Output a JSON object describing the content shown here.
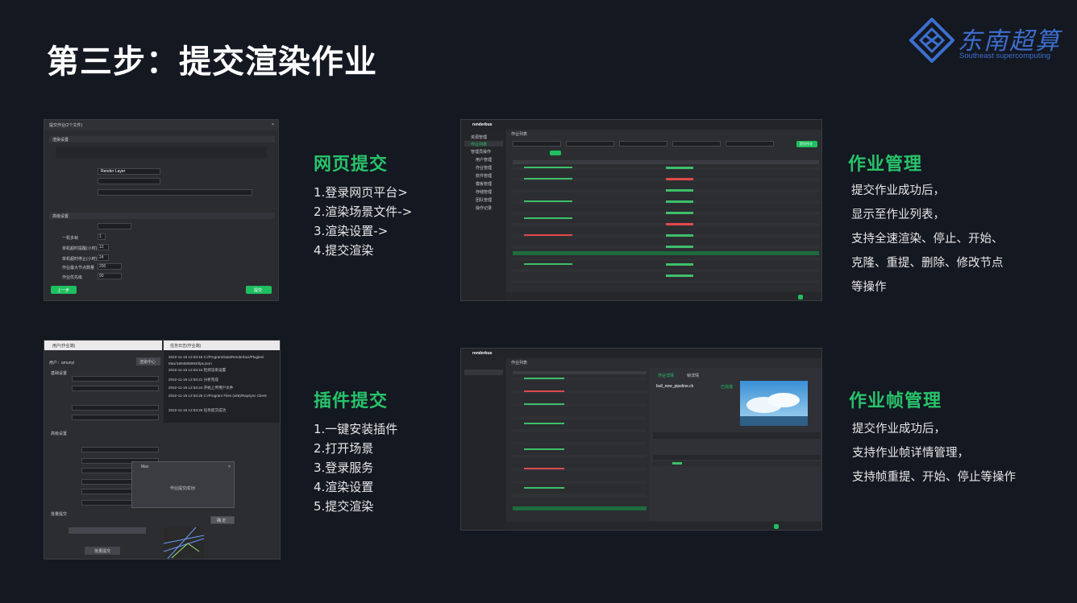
{
  "page": {
    "title": "第三步：提交渲染作业"
  },
  "logo": {
    "cn": "东南超算",
    "en": "Southeast supercomputing"
  },
  "sections": {
    "web": {
      "title": "网页提交",
      "steps": [
        "1.登录网页平台>",
        "2.渲染场景文件->",
        "3.渲染设置->",
        "4.提交渲染"
      ]
    },
    "jobs": {
      "title": "作业管理",
      "desc": [
        "提交作业成功后，",
        "显示至作业列表，",
        "支持全速渲染、停止、开始、",
        "克隆、重提、删除、修改节点",
        "等操作"
      ]
    },
    "plugin": {
      "title": "插件提交",
      "steps": [
        "1.一键安装插件",
        "2.打开场景",
        "3.登录服务",
        "4.渲染设置",
        "5.提交渲染"
      ]
    },
    "frames": {
      "title": "作业帧管理",
      "desc": [
        "提交作业成功后，",
        "支持作业帧详情管理，",
        "支持帧重提、开始、停止等操作"
      ]
    }
  },
  "screens": {
    "submit_dialog": {
      "title": "提交作业(2个文件)",
      "section1": "渲染设置",
      "section2": "高级设置",
      "dropdown_value": "Render Layer",
      "fields": [
        "一机多帧",
        "单机超时提醒(小时)",
        "单机超时停止(小时)",
        "作业最大节点数量",
        "作业优先级"
      ],
      "values": [
        "1",
        "12",
        "24",
        "200",
        "90"
      ],
      "prev_button": "上一步",
      "submit_button": "提交"
    },
    "job_list": {
      "brand": "renderbus",
      "tab": "作业列表",
      "nav": [
        "资源管理",
        "作业列表",
        "管理员操作",
        "用户管理",
        "作业管理",
        "软件管理",
        "模板管理",
        "存储管理",
        "团队管理",
        "操作记录"
      ],
      "submit_button": "提交作业"
    },
    "plugin": {
      "panel_title": "用户(作业端)",
      "log_title": "任务日志(作业端)",
      "user_label": "用户：amunyi",
      "user_button": "渲染中心",
      "base_settings": "基础设置",
      "adv_settings": "高级设置",
      "log_lines": [
        "2022-11-15 12:53:15 C:/ProgramData/Renderbus/Plugins/",
        "Max/1684806693/tips.json",
        "2022-11-15 12:53:15 检测渲染设置",
        "2022-11-15 12:53:21 分析完成",
        "2022-11-15 12:53:24 开始上传用户文件",
        "2022-11-15 12:53:25 C:/Program Files (x86)/Raysync Client",
        "2022-11-15 12:53:26 任务提交成功"
      ],
      "dialog_title": "Max",
      "dialog_msg": "作业提交成功!",
      "dialog_btn": "确 定",
      "batch_label": "批量提交",
      "batch_btn": "批量提交"
    },
    "frames": {
      "brand": "renderbus",
      "tab": "作业列表",
      "detail_tab1": "作业详情",
      "detail_tab2": "帧详情",
      "job_name": "bull_new_pipeline.ck",
      "status": "已完成"
    }
  }
}
